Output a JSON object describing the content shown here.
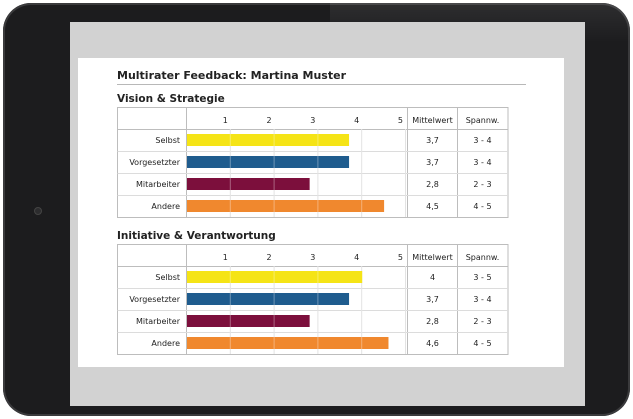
{
  "doc_title": "Multirater Feedback: Martina Muster",
  "chart_data": [
    {
      "type": "bar",
      "title": "Vision & Strategie",
      "categories": [
        "Selbst",
        "Vorgesetzter",
        "Mitarbeiter",
        "Andere"
      ],
      "values": [
        3.7,
        3.7,
        2.8,
        4.5
      ],
      "xlim": [
        0,
        5
      ],
      "ticks": [
        1,
        2,
        3,
        4,
        5
      ],
      "colors": [
        "#f5e416",
        "#1f5c8e",
        "#7c0f3c",
        "#f0882e"
      ],
      "columns": [
        "Mittelwert",
        "Spannw."
      ],
      "mittelwert": [
        "3,7",
        "3,7",
        "2,8",
        "4,5"
      ],
      "spannweite": [
        "3 - 4",
        "3 - 4",
        "2 - 3",
        "4 - 5"
      ]
    },
    {
      "type": "bar",
      "title": "Initiative & Verantwortung",
      "categories": [
        "Selbst",
        "Vorgesetzter",
        "Mitarbeiter",
        "Andere"
      ],
      "values": [
        4.0,
        3.7,
        2.8,
        4.6
      ],
      "xlim": [
        0,
        5
      ],
      "ticks": [
        1,
        2,
        3,
        4,
        5
      ],
      "colors": [
        "#f5e416",
        "#1f5c8e",
        "#7c0f3c",
        "#f0882e"
      ],
      "columns": [
        "Mittelwert",
        "Spannw."
      ],
      "mittelwert": [
        "4",
        "3,7",
        "2,8",
        "4,6"
      ],
      "spannweite": [
        "3 - 5",
        "3 - 4",
        "2 - 3",
        "4 - 5"
      ]
    }
  ]
}
